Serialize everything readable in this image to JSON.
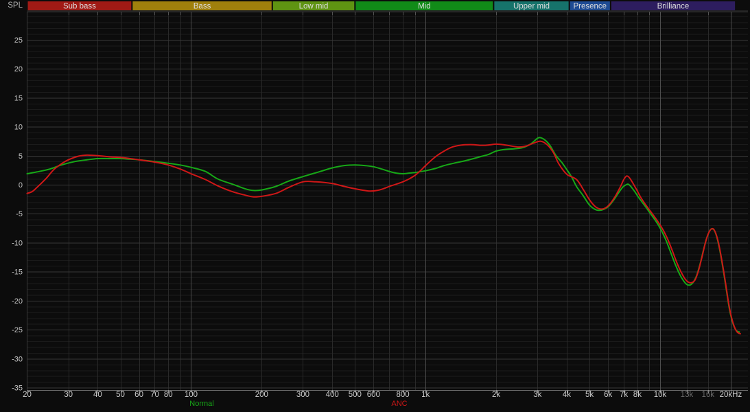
{
  "bands": [
    {
      "label": "Sub bass",
      "f_start": 20,
      "f_end": 56,
      "color": "#a11a15"
    },
    {
      "label": "Bass",
      "f_start": 56,
      "f_end": 222,
      "color": "#a0800c"
    },
    {
      "label": "Low mid",
      "f_start": 222,
      "f_end": 500,
      "color": "#5f9412"
    },
    {
      "label": "Mid",
      "f_start": 500,
      "f_end": 1950,
      "color": "#118b18"
    },
    {
      "label": "Upper mid",
      "f_start": 1950,
      "f_end": 4100,
      "color": "#16736b"
    },
    {
      "label": "Presence",
      "f_start": 4100,
      "f_end": 6150,
      "color": "#1e4b94"
    },
    {
      "label": "Brilliance",
      "f_start": 6150,
      "f_end": 21000,
      "color": "#2d1d5f"
    }
  ],
  "band_text_color": "#dcdcdc",
  "chart_data": {
    "type": "line",
    "title": "",
    "ylabel": "SPL",
    "x_scale": "log",
    "xlim": [
      20,
      22000
    ],
    "ylim": [
      -35,
      30
    ],
    "grid": "on",
    "y_major_step": 5,
    "y_minor_step": 1,
    "legend_position": "bottom",
    "y_ticks": [
      25,
      20,
      15,
      10,
      5,
      0,
      -5,
      -10,
      -15,
      -20,
      -25,
      -30,
      -35
    ],
    "x_ticks": [
      {
        "label": "20",
        "f": 20
      },
      {
        "label": "30",
        "f": 30
      },
      {
        "label": "40",
        "f": 40
      },
      {
        "label": "50",
        "f": 50
      },
      {
        "label": "60",
        "f": 60
      },
      {
        "label": "70",
        "f": 70
      },
      {
        "label": "80",
        "f": 80
      },
      {
        "label": "100",
        "f": 100
      },
      {
        "label": "200",
        "f": 200
      },
      {
        "label": "300",
        "f": 300
      },
      {
        "label": "400",
        "f": 400
      },
      {
        "label": "500",
        "f": 500
      },
      {
        "label": "600",
        "f": 600
      },
      {
        "label": "800",
        "f": 800
      },
      {
        "label": "1k",
        "f": 1000
      },
      {
        "label": "2k",
        "f": 2000
      },
      {
        "label": "3k",
        "f": 3000
      },
      {
        "label": "4k",
        "f": 4000
      },
      {
        "label": "5k",
        "f": 5000
      },
      {
        "label": "6k",
        "f": 6000
      },
      {
        "label": "7k",
        "f": 7000
      },
      {
        "label": "8k",
        "f": 8000
      },
      {
        "label": "10k",
        "f": 10000
      },
      {
        "label": "13k",
        "f": 13000,
        "dim": true
      },
      {
        "label": "16k",
        "f": 16000,
        "dim": true
      },
      {
        "label": "20kHz",
        "f": 20000
      }
    ],
    "x_gridlines_minor": [
      30,
      40,
      50,
      60,
      70,
      80,
      90,
      200,
      300,
      400,
      500,
      600,
      700,
      800,
      900,
      2000,
      3000,
      4000,
      5000,
      6000,
      7000,
      8000,
      9000,
      13000,
      16000
    ],
    "x_gridlines_decade": [
      100,
      1000,
      10000,
      20000
    ],
    "series": [
      {
        "name": "Normal",
        "color": "#17a817",
        "points": [
          [
            20,
            1.9
          ],
          [
            22,
            2.2
          ],
          [
            25,
            2.7
          ],
          [
            28,
            3.4
          ],
          [
            32,
            4.0
          ],
          [
            36,
            4.3
          ],
          [
            40,
            4.5
          ],
          [
            45,
            4.5
          ],
          [
            50,
            4.5
          ],
          [
            55,
            4.4
          ],
          [
            60,
            4.3
          ],
          [
            70,
            4.0
          ],
          [
            80,
            3.7
          ],
          [
            90,
            3.4
          ],
          [
            100,
            3.0
          ],
          [
            115,
            2.3
          ],
          [
            130,
            1.0
          ],
          [
            150,
            0.1
          ],
          [
            170,
            -0.7
          ],
          [
            185,
            -1.0
          ],
          [
            200,
            -0.9
          ],
          [
            230,
            -0.3
          ],
          [
            260,
            0.6
          ],
          [
            300,
            1.4
          ],
          [
            350,
            2.2
          ],
          [
            400,
            2.9
          ],
          [
            450,
            3.3
          ],
          [
            500,
            3.4
          ],
          [
            550,
            3.3
          ],
          [
            600,
            3.1
          ],
          [
            650,
            2.7
          ],
          [
            700,
            2.3
          ],
          [
            750,
            2.0
          ],
          [
            800,
            1.9
          ],
          [
            850,
            2.0
          ],
          [
            900,
            2.1
          ],
          [
            1000,
            2.4
          ],
          [
            1100,
            2.8
          ],
          [
            1200,
            3.3
          ],
          [
            1350,
            3.8
          ],
          [
            1500,
            4.2
          ],
          [
            1700,
            4.8
          ],
          [
            1850,
            5.2
          ],
          [
            2000,
            5.8
          ],
          [
            2200,
            6.1
          ],
          [
            2400,
            6.2
          ],
          [
            2600,
            6.4
          ],
          [
            2800,
            7.0
          ],
          [
            3000,
            8.0
          ],
          [
            3100,
            8.1
          ],
          [
            3250,
            7.6
          ],
          [
            3400,
            6.7
          ],
          [
            3600,
            5.0
          ],
          [
            3800,
            3.9
          ],
          [
            4000,
            2.6
          ],
          [
            4200,
            1.3
          ],
          [
            4400,
            -0.3
          ],
          [
            4700,
            -1.9
          ],
          [
            5000,
            -3.5
          ],
          [
            5300,
            -4.3
          ],
          [
            5500,
            -4.4
          ],
          [
            5700,
            -4.3
          ],
          [
            6000,
            -3.8
          ],
          [
            6300,
            -2.8
          ],
          [
            6600,
            -1.6
          ],
          [
            6900,
            -0.5
          ],
          [
            7100,
            -0.1
          ],
          [
            7300,
            0.1
          ],
          [
            7500,
            -0.3
          ],
          [
            7800,
            -1.2
          ],
          [
            8100,
            -2.2
          ],
          [
            8600,
            -3.6
          ],
          [
            9100,
            -5.0
          ],
          [
            9600,
            -6.3
          ],
          [
            10100,
            -7.8
          ],
          [
            10600,
            -9.6
          ],
          [
            11100,
            -11.7
          ],
          [
            11600,
            -13.7
          ],
          [
            12100,
            -15.4
          ],
          [
            12600,
            -16.6
          ],
          [
            13000,
            -17.2
          ],
          [
            13400,
            -17.3
          ],
          [
            13800,
            -16.9
          ],
          [
            14300,
            -15.7
          ],
          [
            14800,
            -13.7
          ],
          [
            15300,
            -11.3
          ],
          [
            15800,
            -9.2
          ],
          [
            16300,
            -7.9
          ],
          [
            16700,
            -7.6
          ],
          [
            17100,
            -8.0
          ],
          [
            17600,
            -9.6
          ],
          [
            18100,
            -12.0
          ],
          [
            18600,
            -14.8
          ],
          [
            19100,
            -17.8
          ],
          [
            19600,
            -20.7
          ],
          [
            20000,
            -22.5
          ],
          [
            20600,
            -24.3
          ],
          [
            21200,
            -25.2
          ],
          [
            21800,
            -25.4
          ]
        ]
      },
      {
        "name": "ANC",
        "color": "#cf1717",
        "points": [
          [
            20,
            -1.5
          ],
          [
            21,
            -1.2
          ],
          [
            22,
            -0.5
          ],
          [
            24,
            1.0
          ],
          [
            26,
            2.6
          ],
          [
            28,
            3.6
          ],
          [
            30,
            4.3
          ],
          [
            33,
            4.9
          ],
          [
            36,
            5.1
          ],
          [
            40,
            5.0
          ],
          [
            45,
            4.8
          ],
          [
            50,
            4.7
          ],
          [
            55,
            4.5
          ],
          [
            60,
            4.3
          ],
          [
            70,
            3.9
          ],
          [
            80,
            3.4
          ],
          [
            90,
            2.7
          ],
          [
            100,
            1.9
          ],
          [
            115,
            0.9
          ],
          [
            130,
            -0.2
          ],
          [
            150,
            -1.2
          ],
          [
            170,
            -1.8
          ],
          [
            185,
            -2.1
          ],
          [
            200,
            -2.0
          ],
          [
            230,
            -1.5
          ],
          [
            260,
            -0.5
          ],
          [
            300,
            0.5
          ],
          [
            340,
            0.5
          ],
          [
            400,
            0.2
          ],
          [
            450,
            -0.3
          ],
          [
            500,
            -0.7
          ],
          [
            550,
            -1.0
          ],
          [
            580,
            -1.1
          ],
          [
            620,
            -1.0
          ],
          [
            660,
            -0.7
          ],
          [
            700,
            -0.3
          ],
          [
            750,
            0.1
          ],
          [
            800,
            0.5
          ],
          [
            850,
            1.0
          ],
          [
            900,
            1.6
          ],
          [
            950,
            2.4
          ],
          [
            1000,
            3.3
          ],
          [
            1100,
            4.8
          ],
          [
            1200,
            5.8
          ],
          [
            1300,
            6.5
          ],
          [
            1400,
            6.8
          ],
          [
            1500,
            6.9
          ],
          [
            1600,
            6.9
          ],
          [
            1700,
            6.8
          ],
          [
            1800,
            6.8
          ],
          [
            1900,
            6.9
          ],
          [
            2000,
            7.0
          ],
          [
            2150,
            6.9
          ],
          [
            2300,
            6.7
          ],
          [
            2500,
            6.5
          ],
          [
            2700,
            6.7
          ],
          [
            2900,
            7.2
          ],
          [
            3100,
            7.5
          ],
          [
            3300,
            6.9
          ],
          [
            3500,
            5.6
          ],
          [
            3700,
            3.6
          ],
          [
            4000,
            1.8
          ],
          [
            4400,
            0.9
          ],
          [
            4700,
            -0.8
          ],
          [
            5000,
            -2.6
          ],
          [
            5300,
            -3.8
          ],
          [
            5600,
            -4.2
          ],
          [
            5900,
            -3.9
          ],
          [
            6200,
            -3.0
          ],
          [
            6500,
            -1.7
          ],
          [
            6800,
            -0.2
          ],
          [
            7000,
            0.9
          ],
          [
            7200,
            1.5
          ],
          [
            7400,
            1.2
          ],
          [
            7700,
            0.1
          ],
          [
            8000,
            -1.1
          ],
          [
            8300,
            -2.3
          ],
          [
            8800,
            -3.8
          ],
          [
            9300,
            -5.1
          ],
          [
            9800,
            -6.4
          ],
          [
            10300,
            -7.8
          ],
          [
            10800,
            -9.5
          ],
          [
            11300,
            -11.5
          ],
          [
            11800,
            -13.5
          ],
          [
            12300,
            -15.1
          ],
          [
            12800,
            -16.3
          ],
          [
            13200,
            -16.8
          ],
          [
            13600,
            -16.9
          ],
          [
            14100,
            -16.4
          ],
          [
            14600,
            -14.7
          ],
          [
            15100,
            -12.4
          ],
          [
            15600,
            -10.0
          ],
          [
            16100,
            -8.3
          ],
          [
            16600,
            -7.6
          ],
          [
            17000,
            -7.8
          ],
          [
            17500,
            -9.1
          ],
          [
            18000,
            -11.3
          ],
          [
            18500,
            -14.0
          ],
          [
            19000,
            -16.9
          ],
          [
            19500,
            -19.9
          ],
          [
            20000,
            -22.3
          ],
          [
            20600,
            -24.2
          ],
          [
            21300,
            -25.4
          ],
          [
            22000,
            -25.7
          ]
        ]
      }
    ]
  }
}
